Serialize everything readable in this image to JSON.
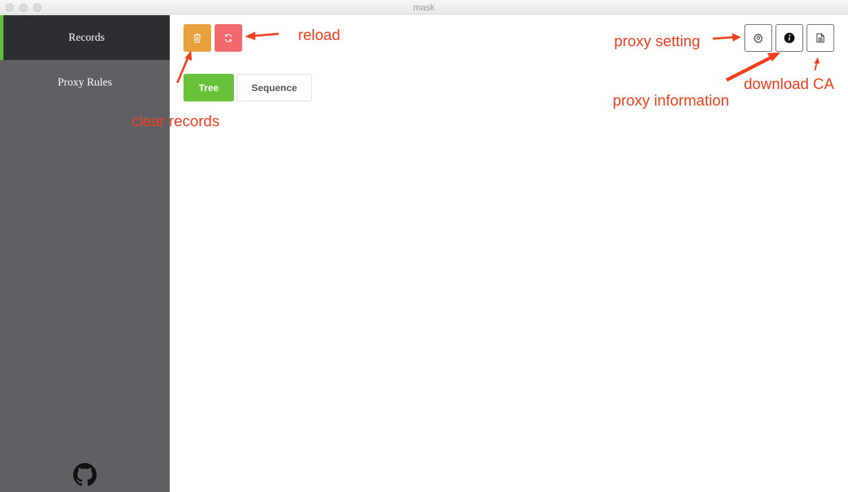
{
  "window": {
    "title": "mask"
  },
  "sidebar": {
    "items": [
      {
        "label": "Records",
        "active": true
      },
      {
        "label": "Proxy Rules",
        "active": false
      }
    ],
    "footer_icon": "github-icon"
  },
  "toolbar": {
    "clear_icon": "trash-icon",
    "reload_icon": "refresh-icon",
    "view_tabs": [
      {
        "label": "Tree",
        "active": true
      },
      {
        "label": "Sequence",
        "active": false
      }
    ],
    "right_icons": [
      "gear-icon",
      "info-icon",
      "document-icon"
    ]
  },
  "annotations": {
    "reload": "reload",
    "proxy_setting": "proxy setting",
    "proxy_information": "proxy information",
    "download_ca": "download CA",
    "clear_records": "clear records"
  },
  "colors": {
    "sidebar_bg": "#5f6064",
    "sidebar_active_bg": "#2d2e31",
    "active_indicator": "#5fbd3d",
    "clear_button": "#e8a13d",
    "reload_button": "#f06a6e",
    "tree_tab": "#67c23a",
    "annotation": "#f0401d"
  }
}
